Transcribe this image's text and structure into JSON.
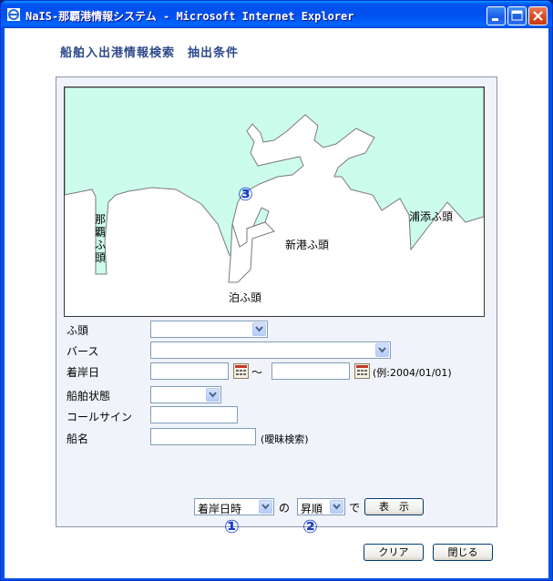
{
  "window": {
    "title": "NaIS-那覇港情報システム - Microsoft Internet Explorer"
  },
  "page": {
    "title": "船舶入出港情報検索　抽出条件"
  },
  "map": {
    "labels": {
      "naha": "那覇ふ頭",
      "shinko": "新港ふ頭",
      "tomari": "泊ふ頭",
      "urasoe": "浦添ふ頭"
    },
    "marker": "③"
  },
  "form": {
    "pier_label": "ふ頭",
    "pier_value": "",
    "berth_label": "バース",
    "berth_value": "",
    "date_label": "着岸日",
    "date_from": "",
    "date_to": "",
    "date_tilde": "～",
    "date_hint": "(例:2004/01/01)",
    "status_label": "船舶状態",
    "status_value": "",
    "callsign_label": "コールサイン",
    "callsign_value": "",
    "shipname_label": "船名",
    "shipname_value": "",
    "shipname_hint": "(曖昧検索)"
  },
  "sort": {
    "field_value": "着岸日時",
    "of_text": "の",
    "order_value": "昇順",
    "de_text": "で",
    "show_label": "表　示",
    "marker1": "①",
    "marker2": "②"
  },
  "footer": {
    "clear_label": "クリア",
    "close_label": "閉じる"
  },
  "colors": {
    "sea": "#ccfcec",
    "title_text": "#2e4a8c",
    "marker": "#1a3fd0"
  }
}
